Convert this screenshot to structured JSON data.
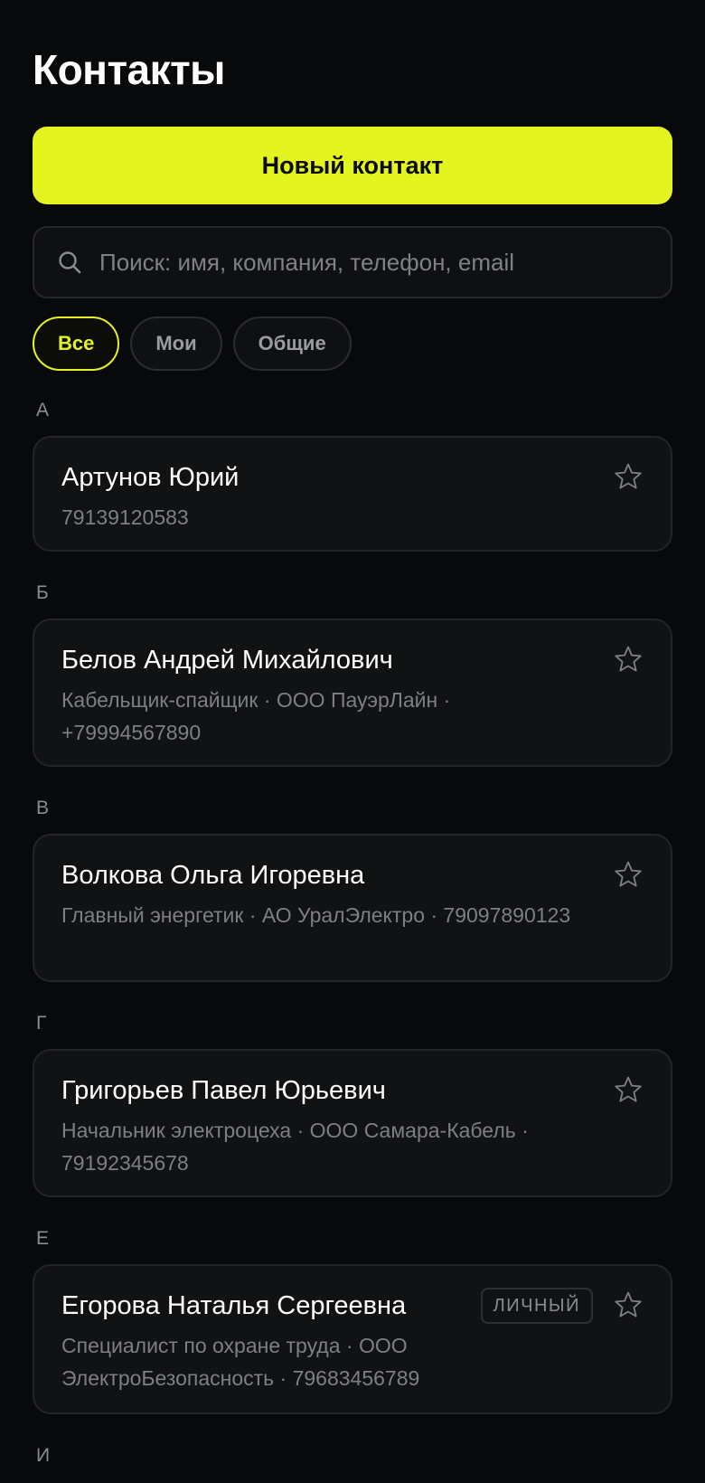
{
  "header": {
    "title": "Контакты"
  },
  "actions": {
    "new_contact_label": "Новый контакт"
  },
  "search": {
    "placeholder": "Поиск: имя, компания, телефон, email",
    "value": ""
  },
  "filters": [
    {
      "label": "Все",
      "active": true
    },
    {
      "label": "Мои",
      "active": false
    },
    {
      "label": "Общие",
      "active": false
    }
  ],
  "groups": [
    {
      "letter": "А",
      "contacts": [
        {
          "name": "Артунов Юрий",
          "subtitle": "79139120583",
          "badge": ""
        }
      ]
    },
    {
      "letter": "Б",
      "contacts": [
        {
          "name": "Белов Андрей Михайлович",
          "subtitle": "Кабельщик-спайщик · ООО ПауэрЛайн · +79994567890",
          "badge": ""
        }
      ]
    },
    {
      "letter": "В",
      "contacts": [
        {
          "name": "Волкова Ольга Игоревна",
          "subtitle": "Главный энергетик · АО УралЭлектро · 79097890123",
          "badge": ""
        }
      ]
    },
    {
      "letter": "Г",
      "contacts": [
        {
          "name": "Григорьев Павел Юрьевич",
          "subtitle": "Начальник электроцеха · ООО Самара-Кабель · 79192345678",
          "badge": ""
        }
      ]
    },
    {
      "letter": "Е",
      "contacts": [
        {
          "name": "Егорова Наталья Сергеевна",
          "subtitle": "Специалист по охране труда · ООО ЭлектроБезопасность · 79683456789",
          "badge": "ЛИЧНЫЙ"
        }
      ]
    },
    {
      "letter": "И",
      "contacts": []
    }
  ],
  "colors": {
    "background": "#08090b",
    "accent": "#e4f420",
    "card": "#111214",
    "muted_text": "#7d7f83"
  },
  "icons": {
    "search": "search-icon",
    "favorite": "star-outline-icon"
  }
}
